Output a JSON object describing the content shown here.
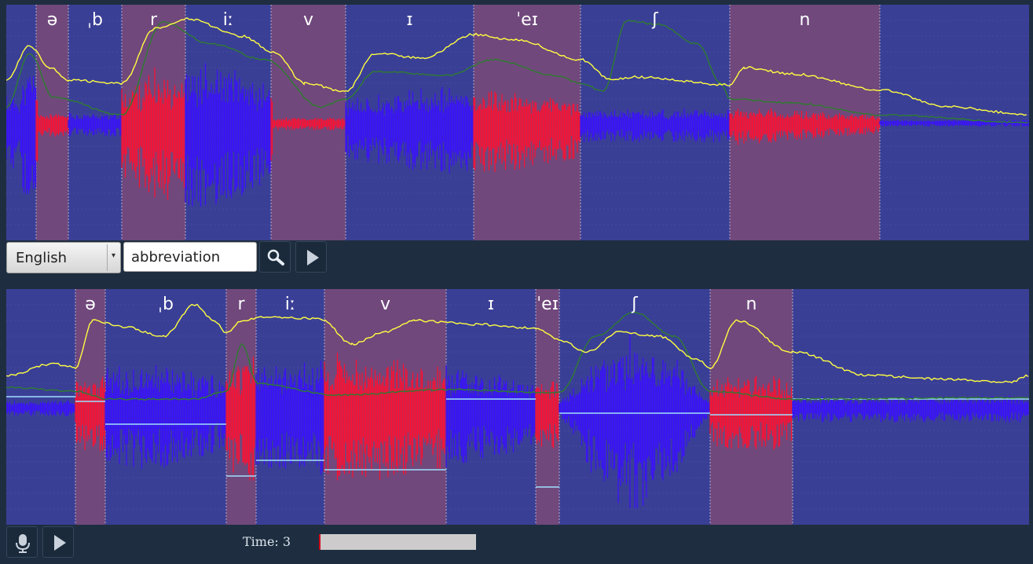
{
  "language_select": {
    "value": "English"
  },
  "word_input": {
    "value": "abbreviation"
  },
  "top_panel": {
    "segments": [
      "",
      "ə",
      "ˌb",
      "r",
      "iː",
      "v",
      "ɪ",
      "ˈeɪ",
      "ʃ",
      "n",
      ""
    ]
  },
  "bottom_panel": {
    "segments": [
      "",
      "ə",
      "ˌb",
      "r",
      "iː",
      "v",
      "ɪ",
      "ˈeɪ",
      "ʃ",
      "n",
      ""
    ]
  },
  "status": {
    "time_label": "Time: 3",
    "progress": 0.01
  },
  "colors": {
    "panel_bg": "#3a3f96",
    "segment_shade": "#7a4a78",
    "waveform_red": "#ff1030",
    "waveform_blue": "#3a10ff",
    "intensity_line": "#ffff40",
    "pitch_line": "#2e7d2e",
    "target_line": "#9fe0ff"
  },
  "icons": {
    "search": "magnifier-icon",
    "play": "play-triangle-icon",
    "record": "microphone-icon"
  }
}
